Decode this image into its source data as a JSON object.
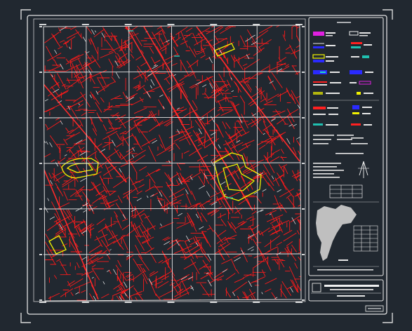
{
  "sheet": {
    "background": "#212830",
    "frame_color": "#e6e6e6",
    "street_color": "#ff1a1a",
    "grid_color": "#e8e8e8",
    "highlight_color": "#f2f200",
    "accent_cyan": "#20c0b0",
    "accent_blue": "#2a2aff",
    "accent_magenta": "#e020e0"
  },
  "legend": {
    "sections": [
      {
        "name": "line-symbols",
        "rows": 4
      },
      {
        "name": "area-symbols",
        "rows": 3
      },
      {
        "name": "notes",
        "rows": 6
      }
    ]
  },
  "map": {
    "grid_columns": 6,
    "grid_rows": 6,
    "highlighted_parcels": 4
  },
  "locator_map": {
    "fill": "#bfbfbf"
  },
  "title_block": {
    "bars": 2
  },
  "icons": [
    "north-arrow-icon",
    "scale-bar-icon"
  ]
}
